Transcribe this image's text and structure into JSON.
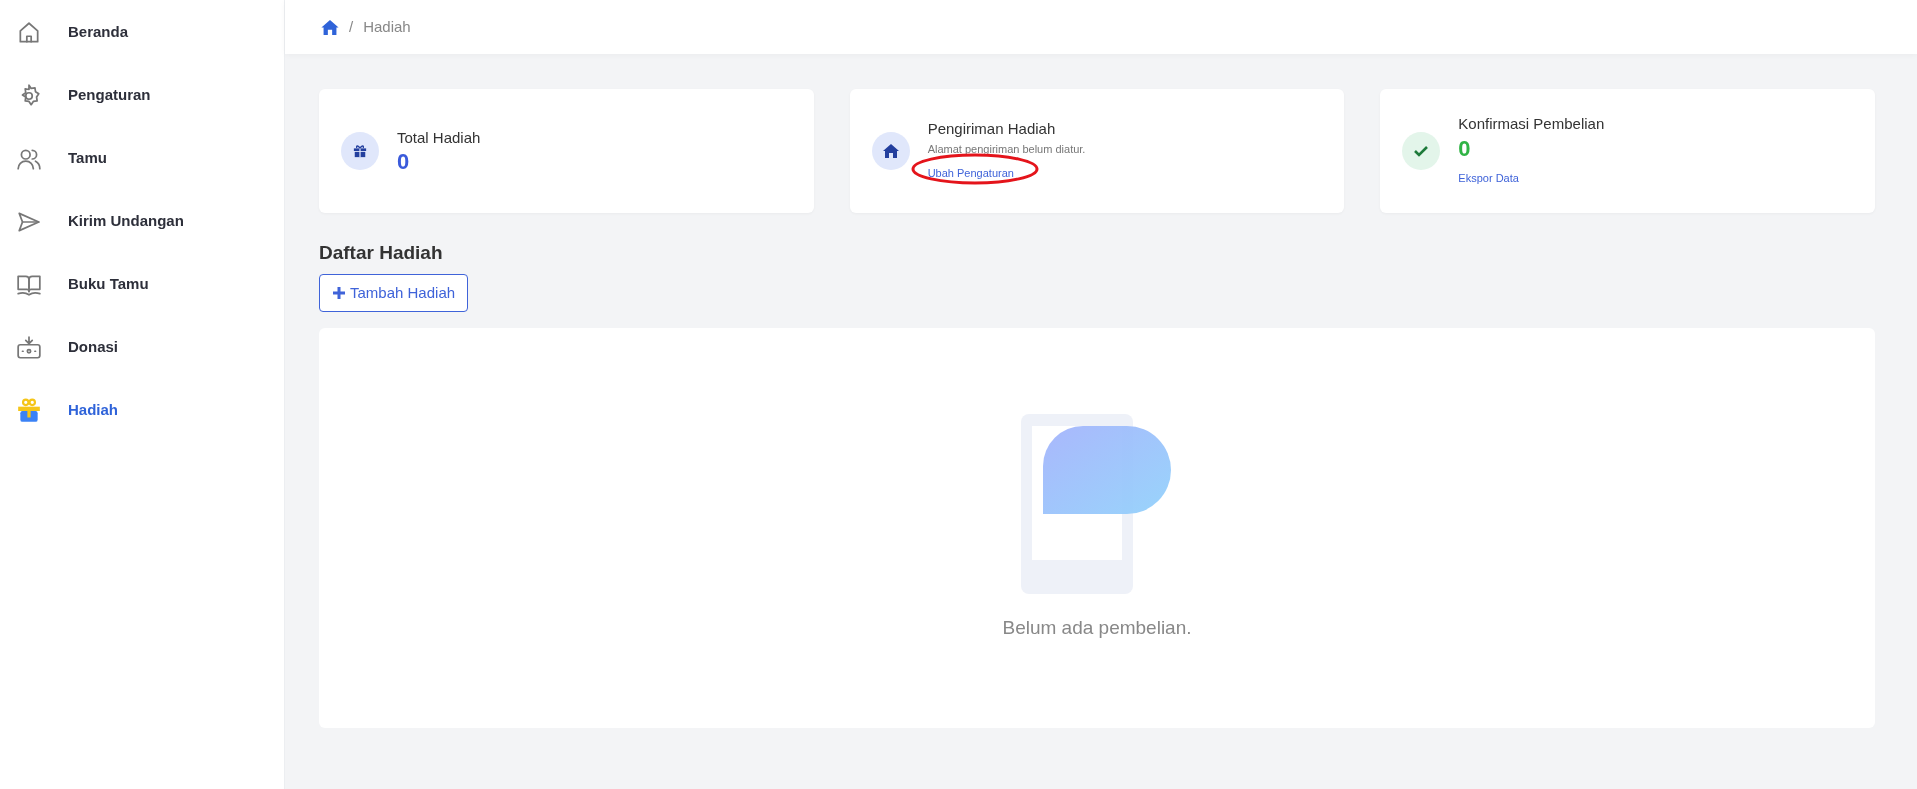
{
  "sidebar": {
    "items": [
      {
        "label": "Beranda",
        "selected": false
      },
      {
        "label": "Pengaturan",
        "selected": false
      },
      {
        "label": "Tamu",
        "selected": false
      },
      {
        "label": "Kirim Undangan",
        "selected": false
      },
      {
        "label": "Buku Tamu",
        "selected": false
      },
      {
        "label": "Donasi",
        "selected": false
      },
      {
        "label": "Hadiah",
        "selected": true
      }
    ]
  },
  "breadcrumb": {
    "separator": "/",
    "current": "Hadiah"
  },
  "stats": [
    {
      "kind": "count",
      "title": "Total Hadiah",
      "value": "0",
      "color": "#3b5bdb"
    },
    {
      "kind": "info",
      "title": "Pengiriman Hadiah",
      "note": "Alamat pengiriman belum diatur.",
      "link": "Ubah Pengaturan",
      "link_circled": true
    },
    {
      "kind": "count",
      "title": "Konfirmasi Pembelian",
      "value": "0",
      "color": "#2fb344",
      "link": "Ekspor Data"
    }
  ],
  "section_title": "Daftar Hadiah",
  "add_button": "Tambah Hadiah",
  "empty_message": "Belum ada pembelian."
}
